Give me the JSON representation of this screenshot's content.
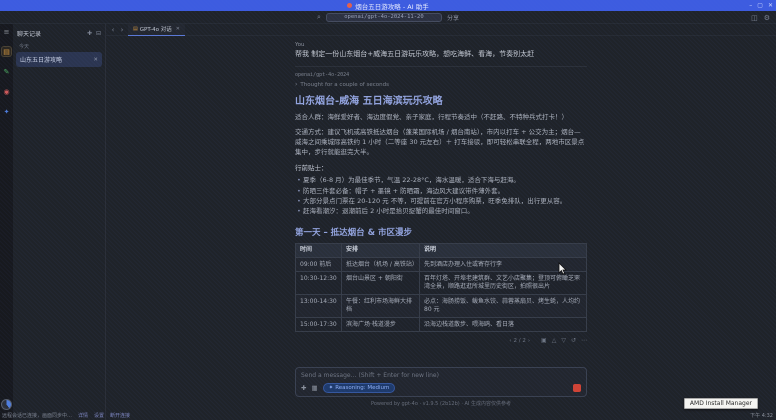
{
  "theme": {
    "titlebar_blue": "#3d5ce0",
    "accent_blue": "#5b79d6",
    "heading_color": "#93a4de",
    "selected_item_bg": "#2b3550",
    "chip_bg": "#1e3a6b",
    "chip_text": "#8fb0f5",
    "stop_red": "#d14334",
    "rail_active_orange": "#d99a3d"
  },
  "titlebar": {
    "title": "烟台五日游攻略 - AI 助手",
    "minimize": "–",
    "maximize": "▢",
    "close": "✕"
  },
  "header": {
    "search_icon": "⌕",
    "omnibox_text": "openai/gpt-4o-2024-11-20",
    "share_label": "分享",
    "layout_icon": "◫",
    "settings_icon": "⚙"
  },
  "rail": {
    "items": [
      {
        "name": "menu",
        "glyph": "≡"
      },
      {
        "name": "chats",
        "glyph": "▤"
      },
      {
        "name": "notes",
        "glyph": "✎"
      },
      {
        "name": "apps",
        "glyph": "◉"
      },
      {
        "name": "settings",
        "glyph": "✦"
      }
    ]
  },
  "sidebar": {
    "title": "聊天记录",
    "new_chat_icon": "✚",
    "collapse_icon": "⊟",
    "section_label": "今天",
    "items": [
      {
        "label": "山东五日游攻略",
        "close_icon": "✕"
      }
    ]
  },
  "tabs": {
    "back": "‹",
    "forward": "›",
    "active": {
      "icon": "▤",
      "label": "GPT-4o 对话",
      "close": "✕"
    }
  },
  "chat": {
    "user_label": "You",
    "user_message": "帮我 制定一份山东烟台+威海五日游玩乐攻略，想吃海鲜、看海，节奏别太赶",
    "model_name": "openai/gpt-4o-2024",
    "thought_chevron": "›",
    "thought_text": "Thought for a couple of seconds",
    "title": "山东烟台-威海 五日海滨玩乐攻略",
    "p1": "适合人群：海鲜爱好者、海边度假党、亲子家庭，行程节奏适中（不赶路、不特种兵式打卡！）",
    "p2": "交通方式：建议飞机或高铁抵达烟台（蓬莱国际机场 / 烟台南站），市内以打车 + 公交为主；烟台—威海之间乘城际高铁约 1 小时（二等座 30 元左右）＋ 打车接驳，即可轻松串联全程，两地市区景点集中，步行就能逛完大半。",
    "tips_label": "行前贴士：",
    "tips": [
      "夏季（6-8 月）为最佳季节，气温 22-28°C，海水温暖，适合下海与赶海。",
      "防晒三件套必备：帽子 + 墨镜 + 防晒霜，海边风大建议带件薄外套。",
      "大部分景点门票在 20-120 元 不等，可提前在官方小程序购票，旺季免排队，出行更从容。",
      "赶海看潮汐：退潮前后 2 小时是拾贝捉蟹的最佳时间窗口。"
    ],
    "day1_title": "第一天 – 抵达烟台 & 市区漫步",
    "table": {
      "headers": [
        "时间",
        "安排",
        "说明"
      ],
      "rows": [
        [
          "09:00 前后",
          "抵达烟台（机场 / 高铁站）",
          "先到酒店办理入住或寄存行李"
        ],
        [
          "10:30-12:30",
          "烟台山景区 + 朝阳街",
          "百年灯塔、开埠老建筑群、文艺小店聚集；登顶可俯瞰芝罘湾全景，顺路逛逛所城里历史街区，拍照很出片"
        ],
        [
          "13:00-14:30",
          "午餐：红利市场海鲜大排档",
          "必点：海肠捞饭、鲅鱼水饺、蒜蓉蒸扇贝、烤生蚝，人均约 80 元"
        ],
        [
          "15:00-17:30",
          "滨海广场·栈道漫步",
          "沿海边栈道散步、喂海鸥、看日落"
        ]
      ]
    },
    "actions": {
      "branch_prev": "‹",
      "branch_label": "2 / 2",
      "branch_next": "›",
      "copy_icon": "▣",
      "thumbs_up_icon": "△",
      "thumbs_down_icon": "▽",
      "regenerate_icon": "↺",
      "more_icon": "⋯"
    }
  },
  "composer": {
    "placeholder": "Send a message… (Shift + Enter for new line)",
    "attach_icon": "✚",
    "image_icon": "▦",
    "chip_icon": "✦",
    "chip_label": "Reasoning: Medium"
  },
  "footer": {
    "note": "Powered by gpt-4o · v1.9.5 (2b12b) · AI 生成内容仅供参考"
  },
  "desktop": {
    "status_text": "远程会话已连接，画面同步中…",
    "links": [
      "详情",
      "设置",
      "断开连接"
    ],
    "tray_time": "下午 4:32",
    "tooltip": "AMD Install Manager"
  }
}
